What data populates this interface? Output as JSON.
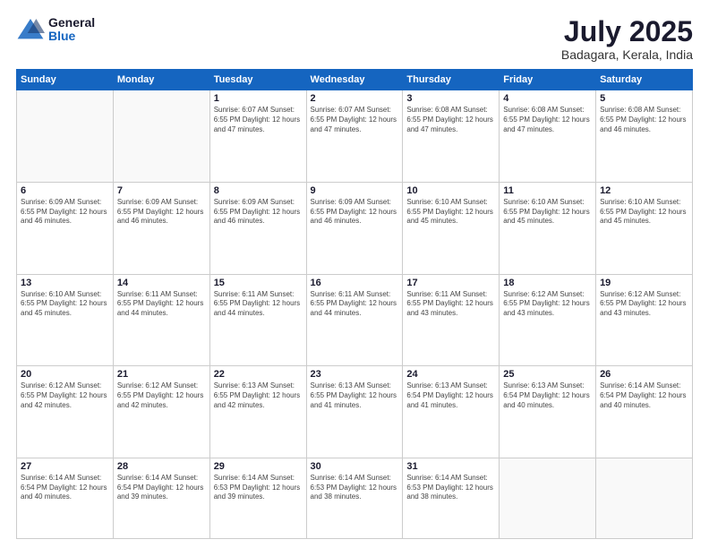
{
  "logo": {
    "general": "General",
    "blue": "Blue"
  },
  "header": {
    "month": "July 2025",
    "location": "Badagara, Kerala, India"
  },
  "weekdays": [
    "Sunday",
    "Monday",
    "Tuesday",
    "Wednesday",
    "Thursday",
    "Friday",
    "Saturday"
  ],
  "weeks": [
    [
      {
        "day": "",
        "info": ""
      },
      {
        "day": "",
        "info": ""
      },
      {
        "day": "1",
        "info": "Sunrise: 6:07 AM\nSunset: 6:55 PM\nDaylight: 12 hours and 47 minutes."
      },
      {
        "day": "2",
        "info": "Sunrise: 6:07 AM\nSunset: 6:55 PM\nDaylight: 12 hours and 47 minutes."
      },
      {
        "day": "3",
        "info": "Sunrise: 6:08 AM\nSunset: 6:55 PM\nDaylight: 12 hours and 47 minutes."
      },
      {
        "day": "4",
        "info": "Sunrise: 6:08 AM\nSunset: 6:55 PM\nDaylight: 12 hours and 47 minutes."
      },
      {
        "day": "5",
        "info": "Sunrise: 6:08 AM\nSunset: 6:55 PM\nDaylight: 12 hours and 46 minutes."
      }
    ],
    [
      {
        "day": "6",
        "info": "Sunrise: 6:09 AM\nSunset: 6:55 PM\nDaylight: 12 hours and 46 minutes."
      },
      {
        "day": "7",
        "info": "Sunrise: 6:09 AM\nSunset: 6:55 PM\nDaylight: 12 hours and 46 minutes."
      },
      {
        "day": "8",
        "info": "Sunrise: 6:09 AM\nSunset: 6:55 PM\nDaylight: 12 hours and 46 minutes."
      },
      {
        "day": "9",
        "info": "Sunrise: 6:09 AM\nSunset: 6:55 PM\nDaylight: 12 hours and 46 minutes."
      },
      {
        "day": "10",
        "info": "Sunrise: 6:10 AM\nSunset: 6:55 PM\nDaylight: 12 hours and 45 minutes."
      },
      {
        "day": "11",
        "info": "Sunrise: 6:10 AM\nSunset: 6:55 PM\nDaylight: 12 hours and 45 minutes."
      },
      {
        "day": "12",
        "info": "Sunrise: 6:10 AM\nSunset: 6:55 PM\nDaylight: 12 hours and 45 minutes."
      }
    ],
    [
      {
        "day": "13",
        "info": "Sunrise: 6:10 AM\nSunset: 6:55 PM\nDaylight: 12 hours and 45 minutes."
      },
      {
        "day": "14",
        "info": "Sunrise: 6:11 AM\nSunset: 6:55 PM\nDaylight: 12 hours and 44 minutes."
      },
      {
        "day": "15",
        "info": "Sunrise: 6:11 AM\nSunset: 6:55 PM\nDaylight: 12 hours and 44 minutes."
      },
      {
        "day": "16",
        "info": "Sunrise: 6:11 AM\nSunset: 6:55 PM\nDaylight: 12 hours and 44 minutes."
      },
      {
        "day": "17",
        "info": "Sunrise: 6:11 AM\nSunset: 6:55 PM\nDaylight: 12 hours and 43 minutes."
      },
      {
        "day": "18",
        "info": "Sunrise: 6:12 AM\nSunset: 6:55 PM\nDaylight: 12 hours and 43 minutes."
      },
      {
        "day": "19",
        "info": "Sunrise: 6:12 AM\nSunset: 6:55 PM\nDaylight: 12 hours and 43 minutes."
      }
    ],
    [
      {
        "day": "20",
        "info": "Sunrise: 6:12 AM\nSunset: 6:55 PM\nDaylight: 12 hours and 42 minutes."
      },
      {
        "day": "21",
        "info": "Sunrise: 6:12 AM\nSunset: 6:55 PM\nDaylight: 12 hours and 42 minutes."
      },
      {
        "day": "22",
        "info": "Sunrise: 6:13 AM\nSunset: 6:55 PM\nDaylight: 12 hours and 42 minutes."
      },
      {
        "day": "23",
        "info": "Sunrise: 6:13 AM\nSunset: 6:55 PM\nDaylight: 12 hours and 41 minutes."
      },
      {
        "day": "24",
        "info": "Sunrise: 6:13 AM\nSunset: 6:54 PM\nDaylight: 12 hours and 41 minutes."
      },
      {
        "day": "25",
        "info": "Sunrise: 6:13 AM\nSunset: 6:54 PM\nDaylight: 12 hours and 40 minutes."
      },
      {
        "day": "26",
        "info": "Sunrise: 6:14 AM\nSunset: 6:54 PM\nDaylight: 12 hours and 40 minutes."
      }
    ],
    [
      {
        "day": "27",
        "info": "Sunrise: 6:14 AM\nSunset: 6:54 PM\nDaylight: 12 hours and 40 minutes."
      },
      {
        "day": "28",
        "info": "Sunrise: 6:14 AM\nSunset: 6:54 PM\nDaylight: 12 hours and 39 minutes."
      },
      {
        "day": "29",
        "info": "Sunrise: 6:14 AM\nSunset: 6:53 PM\nDaylight: 12 hours and 39 minutes."
      },
      {
        "day": "30",
        "info": "Sunrise: 6:14 AM\nSunset: 6:53 PM\nDaylight: 12 hours and 38 minutes."
      },
      {
        "day": "31",
        "info": "Sunrise: 6:14 AM\nSunset: 6:53 PM\nDaylight: 12 hours and 38 minutes."
      },
      {
        "day": "",
        "info": ""
      },
      {
        "day": "",
        "info": ""
      }
    ]
  ]
}
